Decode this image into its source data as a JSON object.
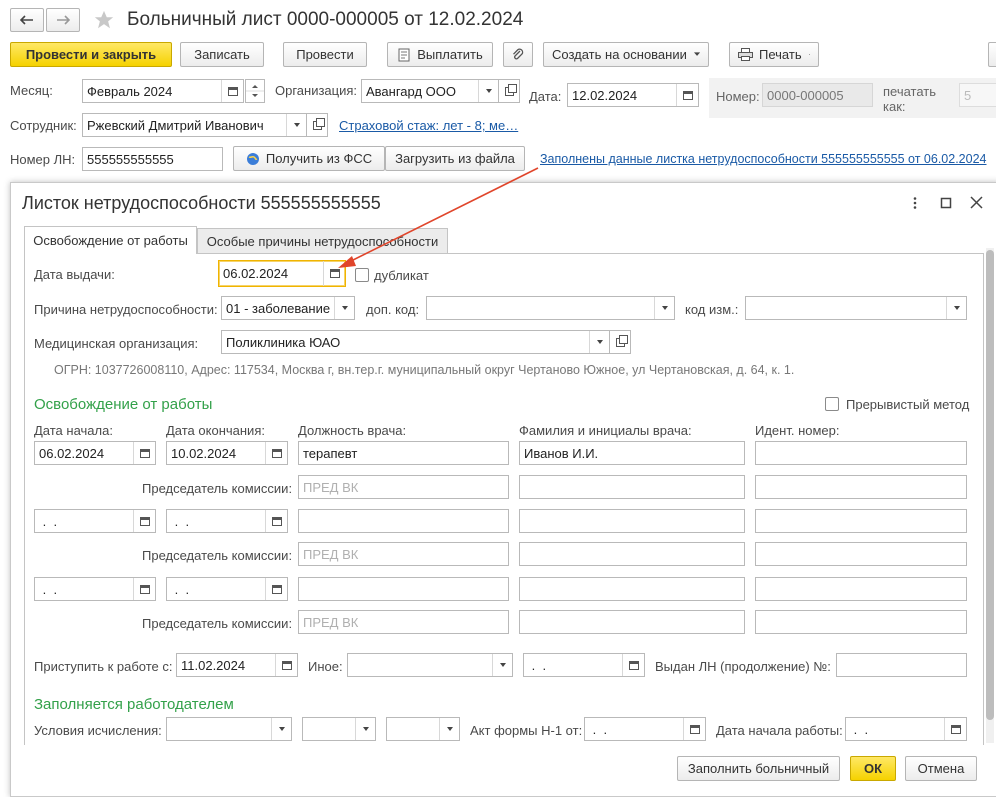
{
  "window": {
    "title": "Больничный лист 0000-000005 от 12.02.2024"
  },
  "toolbar": {
    "post_close": "Провести и закрыть",
    "save": "Записать",
    "post": "Провести",
    "pay": "Выплатить",
    "create_based": "Создать на основании",
    "print": "Печать"
  },
  "header": {
    "month_label": "Месяц:",
    "month_value": "Февраль 2024",
    "org_label": "Организация:",
    "org_value": "Авангард ООО",
    "date_label": "Дата:",
    "date_value": "12.02.2024",
    "number_label": "Номер:",
    "number_value": "0000-000005",
    "print_as_line1": "печатать",
    "print_as_line2": "как:",
    "print_as_value": "5",
    "employee_label": "Сотрудник:",
    "employee_value": "Ржевский Дмитрий Иванович",
    "insurance_link": "Страховой стаж: лет - 8; ме…",
    "ln_label": "Номер ЛН:",
    "ln_value": "555555555555",
    "get_fss": "Получить из ФСС",
    "load_file": "Загрузить из файла",
    "filled_link": "Заполнены данные листка нетрудоспособности 555555555555 от 06.02.2024"
  },
  "dialog": {
    "title": "Листок нетрудоспособности 555555555555",
    "tabs": [
      "Освобождение от работы",
      "Особые причины нетрудоспособности"
    ],
    "issue_date_label": "Дата выдачи:",
    "issue_date_value": "06.02.2024",
    "duplicate_label": "дубликат",
    "reason_label": "Причина нетрудоспособности:",
    "reason_value": "01 - заболевание",
    "extra_code_label": "доп. код:",
    "change_code_label": "код изм.:",
    "med_org_label": "Медицинская организация:",
    "med_org_value": "Поликлиника ЮАО",
    "med_org_info": "ОГРН: 1037726008110, Адрес: 117534, Москва г, вн.тер.г. муниципальный округ Чертаново Южное, ул Чертановская, д. 64, к. 1.",
    "release_section": "Освобождение от работы",
    "intermittent_label": "Прерывистый метод",
    "col_start": "Дата начала:",
    "col_end": "Дата окончания:",
    "col_position": "Должность врача:",
    "col_doctor": "Фамилия и инициалы врача:",
    "col_id": "Идент.  номер:",
    "rows": [
      {
        "start": "06.02.2024",
        "end": "10.02.2024",
        "position": "терапевт",
        "doctor": "Иванов И.И.",
        "id": ""
      },
      {
        "start": " .  .",
        "end": " .  .",
        "position": "",
        "doctor": "",
        "id": ""
      },
      {
        "start": " .  .",
        "end": " .  .",
        "position": "",
        "doctor": "",
        "id": ""
      }
    ],
    "chair_label": "Председатель комиссии:",
    "chair_placeholder": "ПРЕД ВК",
    "return_label": "Приступить к работе с:",
    "return_value": "11.02.2024",
    "other_label": "Иное:",
    "other_date": " .  .",
    "continuation_label": "Выдан ЛН (продолжение) №:",
    "employer_section": "Заполняется работодателем",
    "calc_cond_label": "Условия исчисления:",
    "act_label": "Акт формы Н-1 от:",
    "act_value": " .  .",
    "work_start_label": "Дата начала работы:",
    "work_start_value": " .  .",
    "fill_button": "Заполнить больничный",
    "ok_button": "ОК",
    "cancel_button": "Отмена"
  }
}
